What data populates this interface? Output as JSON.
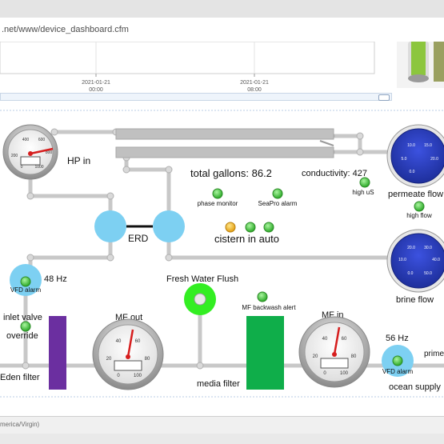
{
  "browser": {
    "url": ".net/www/device_dashboard.cfm"
  },
  "chart": {
    "tick_labels": [
      {
        "date": "2021-01-21",
        "time": "00:00"
      },
      {
        "date": "2021-01-21",
        "time": "08:00"
      }
    ]
  },
  "diagram": {
    "labels": {
      "hp_in": "HP in",
      "total_gallons": "total gallons: 86.2",
      "conductivity": "conductivity: 427",
      "high_us": "high uS",
      "permeate_flow": "permeate flow",
      "high_flow": "high flow",
      "phase_monitor": "phase monitor",
      "seapro_alarm": "SeaPro alarm",
      "erd": "ERD",
      "cistern_in_auto": "cistern in auto",
      "brine_flow": "brine flow",
      "hz_48": "48 Hz",
      "vfd_alarm_left": "VFD alarm",
      "fresh_water_flush": "Fresh Water Flush",
      "mf_backwash_alert": "MF backwash alert",
      "inlet_valve": "inlet valve",
      "override": "override",
      "mf_out": "MF out",
      "mf_in": "MF in",
      "hz_56": "56 Hz",
      "prime": "prime",
      "vfd_alarm_right": "VFD alarm",
      "eden_filter": "Eden filter",
      "media_filter": "media filter",
      "ocean_supply": "ocean supply"
    },
    "gauges": {
      "hp_in": {
        "ticks": [
          "200",
          "400",
          "600",
          "800",
          "1000",
          "0"
        ],
        "value": 800
      },
      "permeate_flow": {
        "ticks": [
          "10.0",
          "15.0",
          "5.0",
          "20.0",
          "0.0"
        ]
      },
      "brine_flow": {
        "ticks": [
          "20.0",
          "30.0",
          "10.0",
          "40.0",
          "0.0",
          "50.0"
        ]
      },
      "mf_out": {
        "ticks": [
          "40",
          "60",
          "20",
          "80",
          "0",
          "100"
        ],
        "value": 62
      },
      "mf_in": {
        "ticks": [
          "40",
          "60",
          "20",
          "80",
          "0",
          "100"
        ],
        "value": 62
      }
    },
    "colors": {
      "pipe": "#c8c8c8",
      "pump_blue": "#7dd0f2",
      "indicator_green": "#3ec83a",
      "indicator_yellow": "#f2b82a",
      "filter_purple": "#6b2fa0",
      "filter_green": "#0fae4a",
      "flush_green": "#33ee22",
      "dial_blue": "#2b3fc9"
    }
  },
  "status": {
    "text": "merica/Virgin)"
  }
}
